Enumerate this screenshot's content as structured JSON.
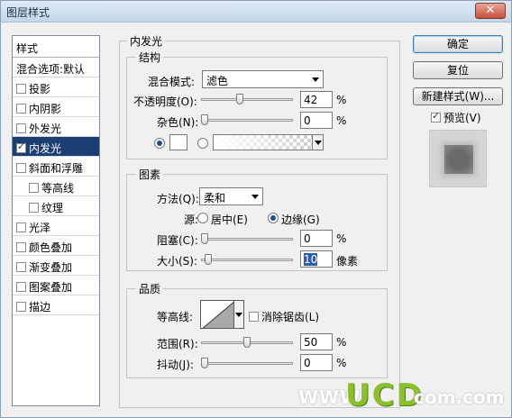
{
  "window": {
    "title": "图层样式",
    "close_glyph": "✕"
  },
  "stylelist": {
    "header": "样式",
    "blend_options": "混合选项:默认",
    "items": [
      {
        "label": "投影",
        "checked": false,
        "sub": false,
        "selected": false
      },
      {
        "label": "内阴影",
        "checked": false,
        "sub": false,
        "selected": false
      },
      {
        "label": "外发光",
        "checked": false,
        "sub": false,
        "selected": false
      },
      {
        "label": "内发光",
        "checked": true,
        "sub": false,
        "selected": true
      },
      {
        "label": "斜面和浮雕",
        "checked": false,
        "sub": false,
        "selected": false
      },
      {
        "label": "等高线",
        "checked": false,
        "sub": true,
        "selected": false
      },
      {
        "label": "纹理",
        "checked": false,
        "sub": true,
        "selected": false
      },
      {
        "label": "光泽",
        "checked": false,
        "sub": false,
        "selected": false
      },
      {
        "label": "颜色叠加",
        "checked": false,
        "sub": false,
        "selected": false
      },
      {
        "label": "渐变叠加",
        "checked": false,
        "sub": false,
        "selected": false
      },
      {
        "label": "图案叠加",
        "checked": false,
        "sub": false,
        "selected": false
      },
      {
        "label": "描边",
        "checked": false,
        "sub": false,
        "selected": false
      }
    ]
  },
  "buttons": {
    "ok": "确定",
    "reset": "复位",
    "new_style": "新建样式(W)...",
    "preview_label": "预览(V)",
    "preview_checked": true
  },
  "panel": {
    "title": "内发光",
    "structure": {
      "title": "结构",
      "blend_mode_label": "混合模式:",
      "blend_mode_value": "滤色",
      "opacity_label": "不透明度(O):",
      "opacity_value": "42",
      "opacity_fraction": 0.42,
      "noise_label": "杂色(N):",
      "noise_value": "0",
      "noise_fraction": 0,
      "percent": "%"
    },
    "elements": {
      "title": "图素",
      "method_label": "方法(Q):",
      "method_value": "柔和",
      "source_label": "源:",
      "source_center": "居中(E)",
      "source_edge": "边缘(G)",
      "choke_label": "阻塞(C):",
      "choke_value": "0",
      "choke_fraction": 0,
      "size_label": "大小(S):",
      "size_value": "10",
      "size_fraction": 0.04,
      "size_unit": "像素",
      "percent": "%"
    },
    "quality": {
      "title": "品质",
      "contour_label": "等高线:",
      "antialias_label": "消除锯齿(L)",
      "range_label": "范围(R):",
      "range_value": "50",
      "range_fraction": 0.5,
      "jitter_label": "抖动(J):",
      "jitter_value": "0",
      "jitter_fraction": 0,
      "percent": "%"
    }
  },
  "watermark": {
    "www": "WWW.",
    "brand": "UCD",
    "com": "com.com"
  },
  "colors": {
    "selection": "#1c3f73",
    "glow_swatch": "#ffffff",
    "accent": "#8cbf2e"
  }
}
